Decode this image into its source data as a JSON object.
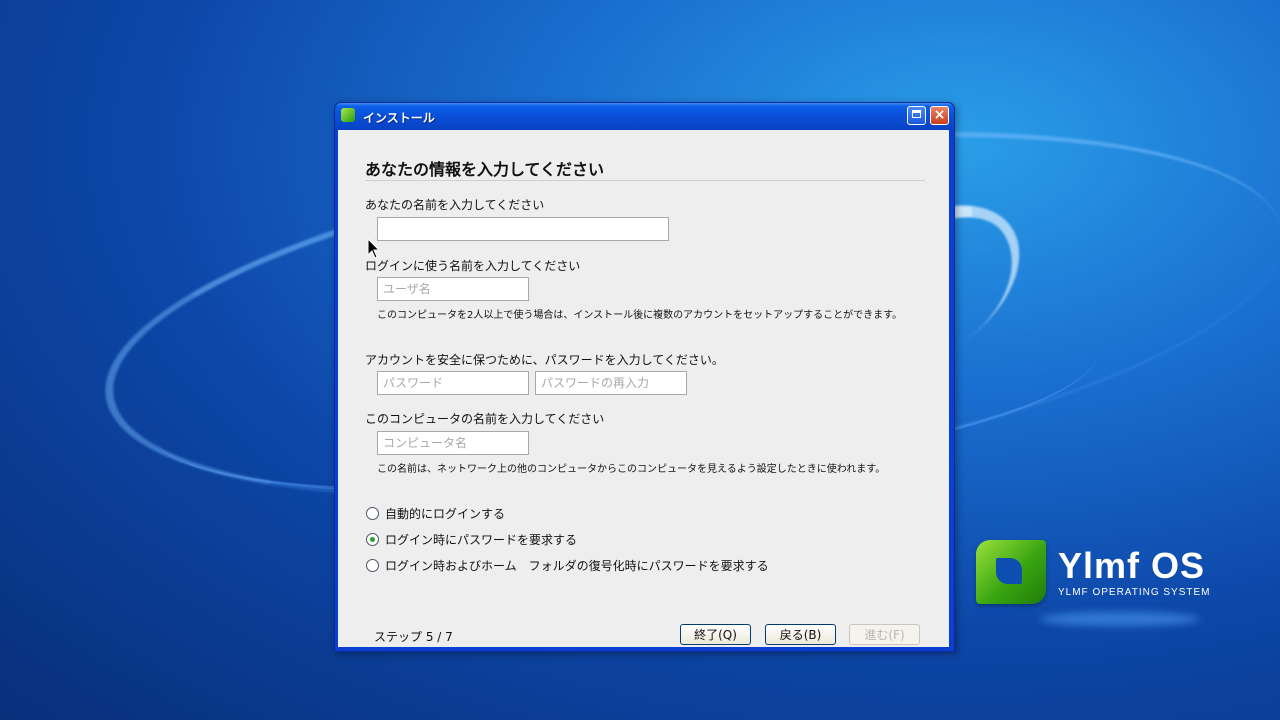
{
  "window": {
    "title": "インストール",
    "close_glyph": "×"
  },
  "form": {
    "heading": "あなたの情報を入力してください",
    "name_label": "あなたの名前を入力してください",
    "name_value": "",
    "login_label": "ログインに使う名前を入力してください",
    "username_placeholder": "ユーザ名",
    "login_note": "このコンピュータを2人以上で使う場合は、インストール後に複数のアカウントをセットアップすることができます。",
    "password_label": "アカウントを安全に保つために、パスワードを入力してください。",
    "password_placeholder": "パスワード",
    "password_confirm_placeholder": "パスワードの再入力",
    "computer_label": "このコンピュータの名前を入力してください",
    "computer_placeholder": "コンピュータ名",
    "computer_note": "この名前は、ネットワーク上の他のコンピュータからこのコンピュータを見えるよう設定したときに使われます。",
    "radio_options": [
      {
        "label": "自動的にログインする",
        "checked": false
      },
      {
        "label": "ログイン時にパスワードを要求する",
        "checked": true
      },
      {
        "label": "ログイン時およびホーム　フォルダの復号化時にパスワードを要求する",
        "checked": false
      }
    ]
  },
  "footer": {
    "step_text": "ステップ 5 / 7",
    "quit_label": "終了(Q)",
    "back_label": "戻る(B)",
    "forward_label": "進む(F)",
    "forward_enabled": false
  },
  "branding": {
    "title": "Ylmf OS",
    "subtitle": "YLMF OPERATING SYSTEM",
    "logo_color": "#3aa512"
  },
  "icons": [
    "app-icon",
    "maximize-icon",
    "close-icon",
    "mouse-cursor-icon"
  ]
}
